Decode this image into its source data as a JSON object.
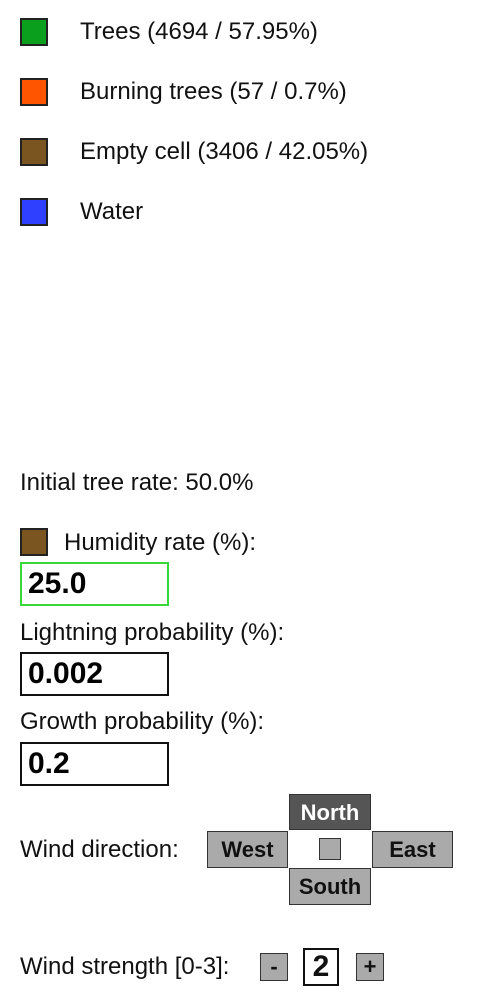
{
  "legend": {
    "items": [
      {
        "label": "Trees (4694 / 57.95%)",
        "color": "#0aa01e"
      },
      {
        "label": "Burning trees (57 / 0.7%)",
        "color": "#ff5500"
      },
      {
        "label": "Empty cell (3406 / 42.05%)",
        "color": "#7a5520"
      },
      {
        "label": "Water",
        "color": "#3040ff"
      }
    ]
  },
  "controls": {
    "initial_tree_rate": "Initial tree rate: 50.0%",
    "humidity": {
      "label": "Humidity rate (%):",
      "value": "25.0",
      "swatch_color": "#7a5520"
    },
    "lightning": {
      "label": "Lightning probability (%):",
      "value": "0.002"
    },
    "growth": {
      "label": "Growth probability (%):",
      "value": "0.2"
    },
    "wind": {
      "label": "Wind direction:",
      "north": "North",
      "west": "West",
      "east": "East",
      "south": "South",
      "selected": "North"
    },
    "wind_strength": {
      "label": "Wind strength [0-3]:",
      "minus": "-",
      "plus": "+",
      "value": "2"
    }
  }
}
